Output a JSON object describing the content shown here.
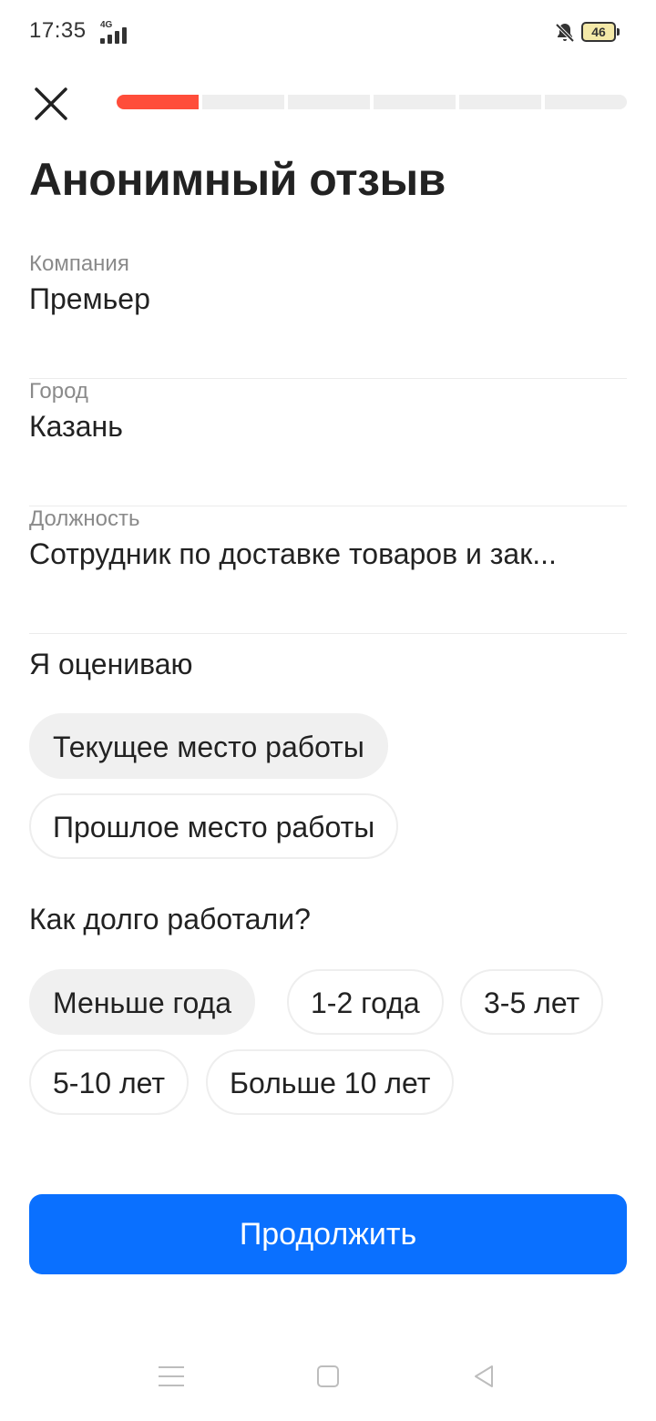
{
  "status_bar": {
    "time": "17:35",
    "network": "4G",
    "battery": "46",
    "icons": [
      "signal-icon",
      "bell-off-icon",
      "battery-icon"
    ]
  },
  "header": {
    "close_icon": "close-icon",
    "progress": {
      "total_steps": 6,
      "current_step": 1,
      "accent": "#ff4d3a"
    }
  },
  "title": "Анонимный отзыв",
  "fields": [
    {
      "label": "Компания",
      "value": "Премьер"
    },
    {
      "label": "Город",
      "value": "Казань"
    },
    {
      "label": "Должность",
      "value": "Сотрудник по доставке товаров и зак..."
    }
  ],
  "evaluate": {
    "title": "Я оцениваю",
    "options": [
      "Текущее место работы",
      "Прошлое место работы"
    ],
    "selected": "Текущее место работы"
  },
  "duration": {
    "title": "Как долго работали?",
    "options": [
      "Меньше года",
      "1-2 года",
      "3-5 лет",
      "5-10 лет",
      "Больше 10 лет"
    ],
    "selected": "Меньше года"
  },
  "continue_label": "Продолжить",
  "colors": {
    "primary": "#0a70ff",
    "accent": "#ff4d3a",
    "chip_selected": "#f0f0f0"
  },
  "nav": {
    "icons": [
      "menu-icon",
      "home-icon",
      "back-icon"
    ]
  }
}
